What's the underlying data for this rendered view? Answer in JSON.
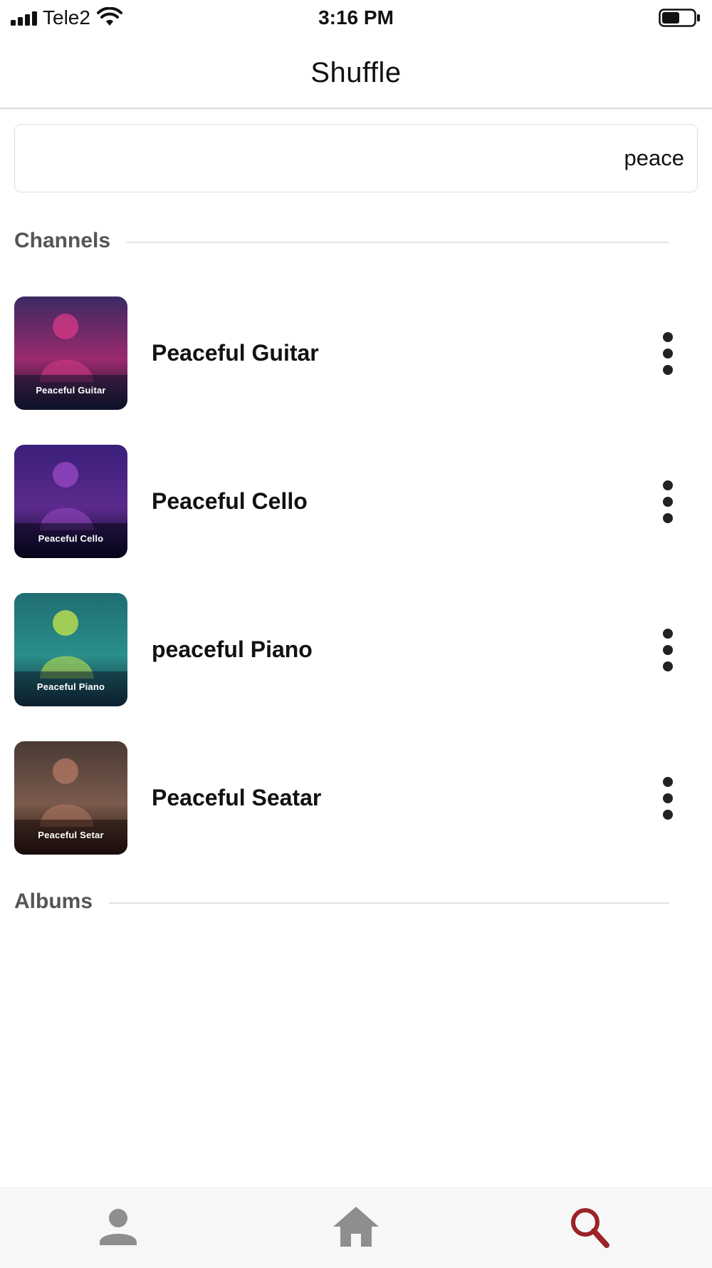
{
  "status_bar": {
    "carrier": "Tele2",
    "time": "3:16 PM",
    "battery_level": 0.55
  },
  "header": {
    "title": "Shuffle"
  },
  "search": {
    "value": "peace",
    "placeholder": ""
  },
  "sections": {
    "channels": "Channels",
    "albums": "Albums"
  },
  "channels": [
    {
      "title": "Peaceful Guitar",
      "thumbnail_caption": "Peaceful Guitar",
      "colors": {
        "top": "#3b2a63",
        "mid": "#9b2a6e",
        "bottom": "#0c1328",
        "figure": "#d83a86"
      }
    },
    {
      "title": "Peaceful Cello",
      "thumbnail_caption": "Peaceful Cello",
      "colors": {
        "top": "#3a1f7a",
        "mid": "#5b2a8c",
        "bottom": "#06061a",
        "figure": "#9b48c7"
      }
    },
    {
      "title": "peaceful Piano",
      "thumbnail_caption": "Peaceful Piano",
      "colors": {
        "top": "#1f6d72",
        "mid": "#2a8f8a",
        "bottom": "#0d2030",
        "figure": "#c8e84a"
      }
    },
    {
      "title": "Peaceful Seatar",
      "thumbnail_caption": "Peaceful Setar",
      "colors": {
        "top": "#4a3a35",
        "mid": "#7a5a4c",
        "bottom": "#1a0c0a",
        "figure": "#b47a63"
      }
    }
  ],
  "bottom_nav": {
    "items": [
      {
        "icon": "person-icon",
        "active": false
      },
      {
        "icon": "home-icon",
        "active": false
      },
      {
        "icon": "search-icon",
        "active": true
      }
    ],
    "active_color": "#9b2226",
    "inactive_color": "#8e8e8e"
  }
}
